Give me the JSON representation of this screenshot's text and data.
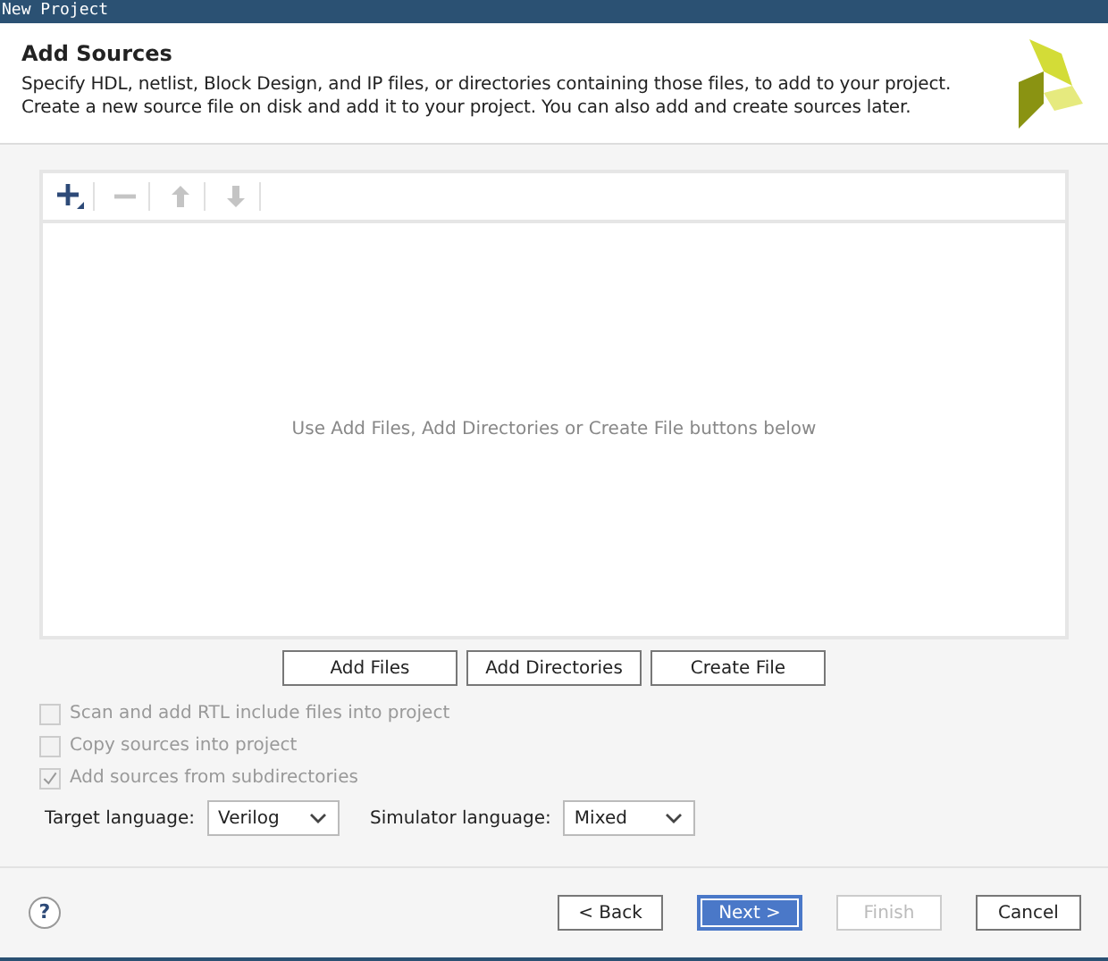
{
  "window": {
    "title": "New Project"
  },
  "header": {
    "title": "Add Sources",
    "description": [
      "Specify HDL, netlist, Block Design, and IP files, or directories containing those files, to add to your project.",
      "Create a new source file on disk and add it to your project. You can also add and create sources later."
    ]
  },
  "toolbar": [
    {
      "kind": "add",
      "disabled": false
    },
    {
      "kind": "remove",
      "disabled": true
    },
    {
      "kind": "up",
      "disabled": true
    },
    {
      "kind": "down",
      "disabled": true
    }
  ],
  "file_list": {
    "empty_message": "Use Add Files, Add Directories or Create File buttons below"
  },
  "list_buttons": [
    {
      "label": "Add Files"
    },
    {
      "label": "Add Directories"
    },
    {
      "label": "Create File"
    }
  ],
  "options": [
    {
      "label": "Scan and add RTL include files into project",
      "checked": false,
      "disabled": true
    },
    {
      "label": "Copy sources into project",
      "checked": false,
      "disabled": true
    },
    {
      "label": "Add sources from subdirectories",
      "checked": true,
      "disabled": true
    }
  ],
  "languages": [
    {
      "label": "Target language:",
      "value": "Verilog"
    },
    {
      "label": "Simulator language:",
      "value": "Mixed"
    }
  ],
  "help_button": {
    "label": "?"
  },
  "footer_buttons": [
    {
      "label": "< Back",
      "selected": false,
      "disabled": false
    },
    {
      "label": "Next >",
      "selected": true,
      "disabled": false
    },
    {
      "label": "Finish",
      "selected": false,
      "disabled": true
    },
    {
      "label": "Cancel",
      "selected": false,
      "disabled": false
    }
  ]
}
